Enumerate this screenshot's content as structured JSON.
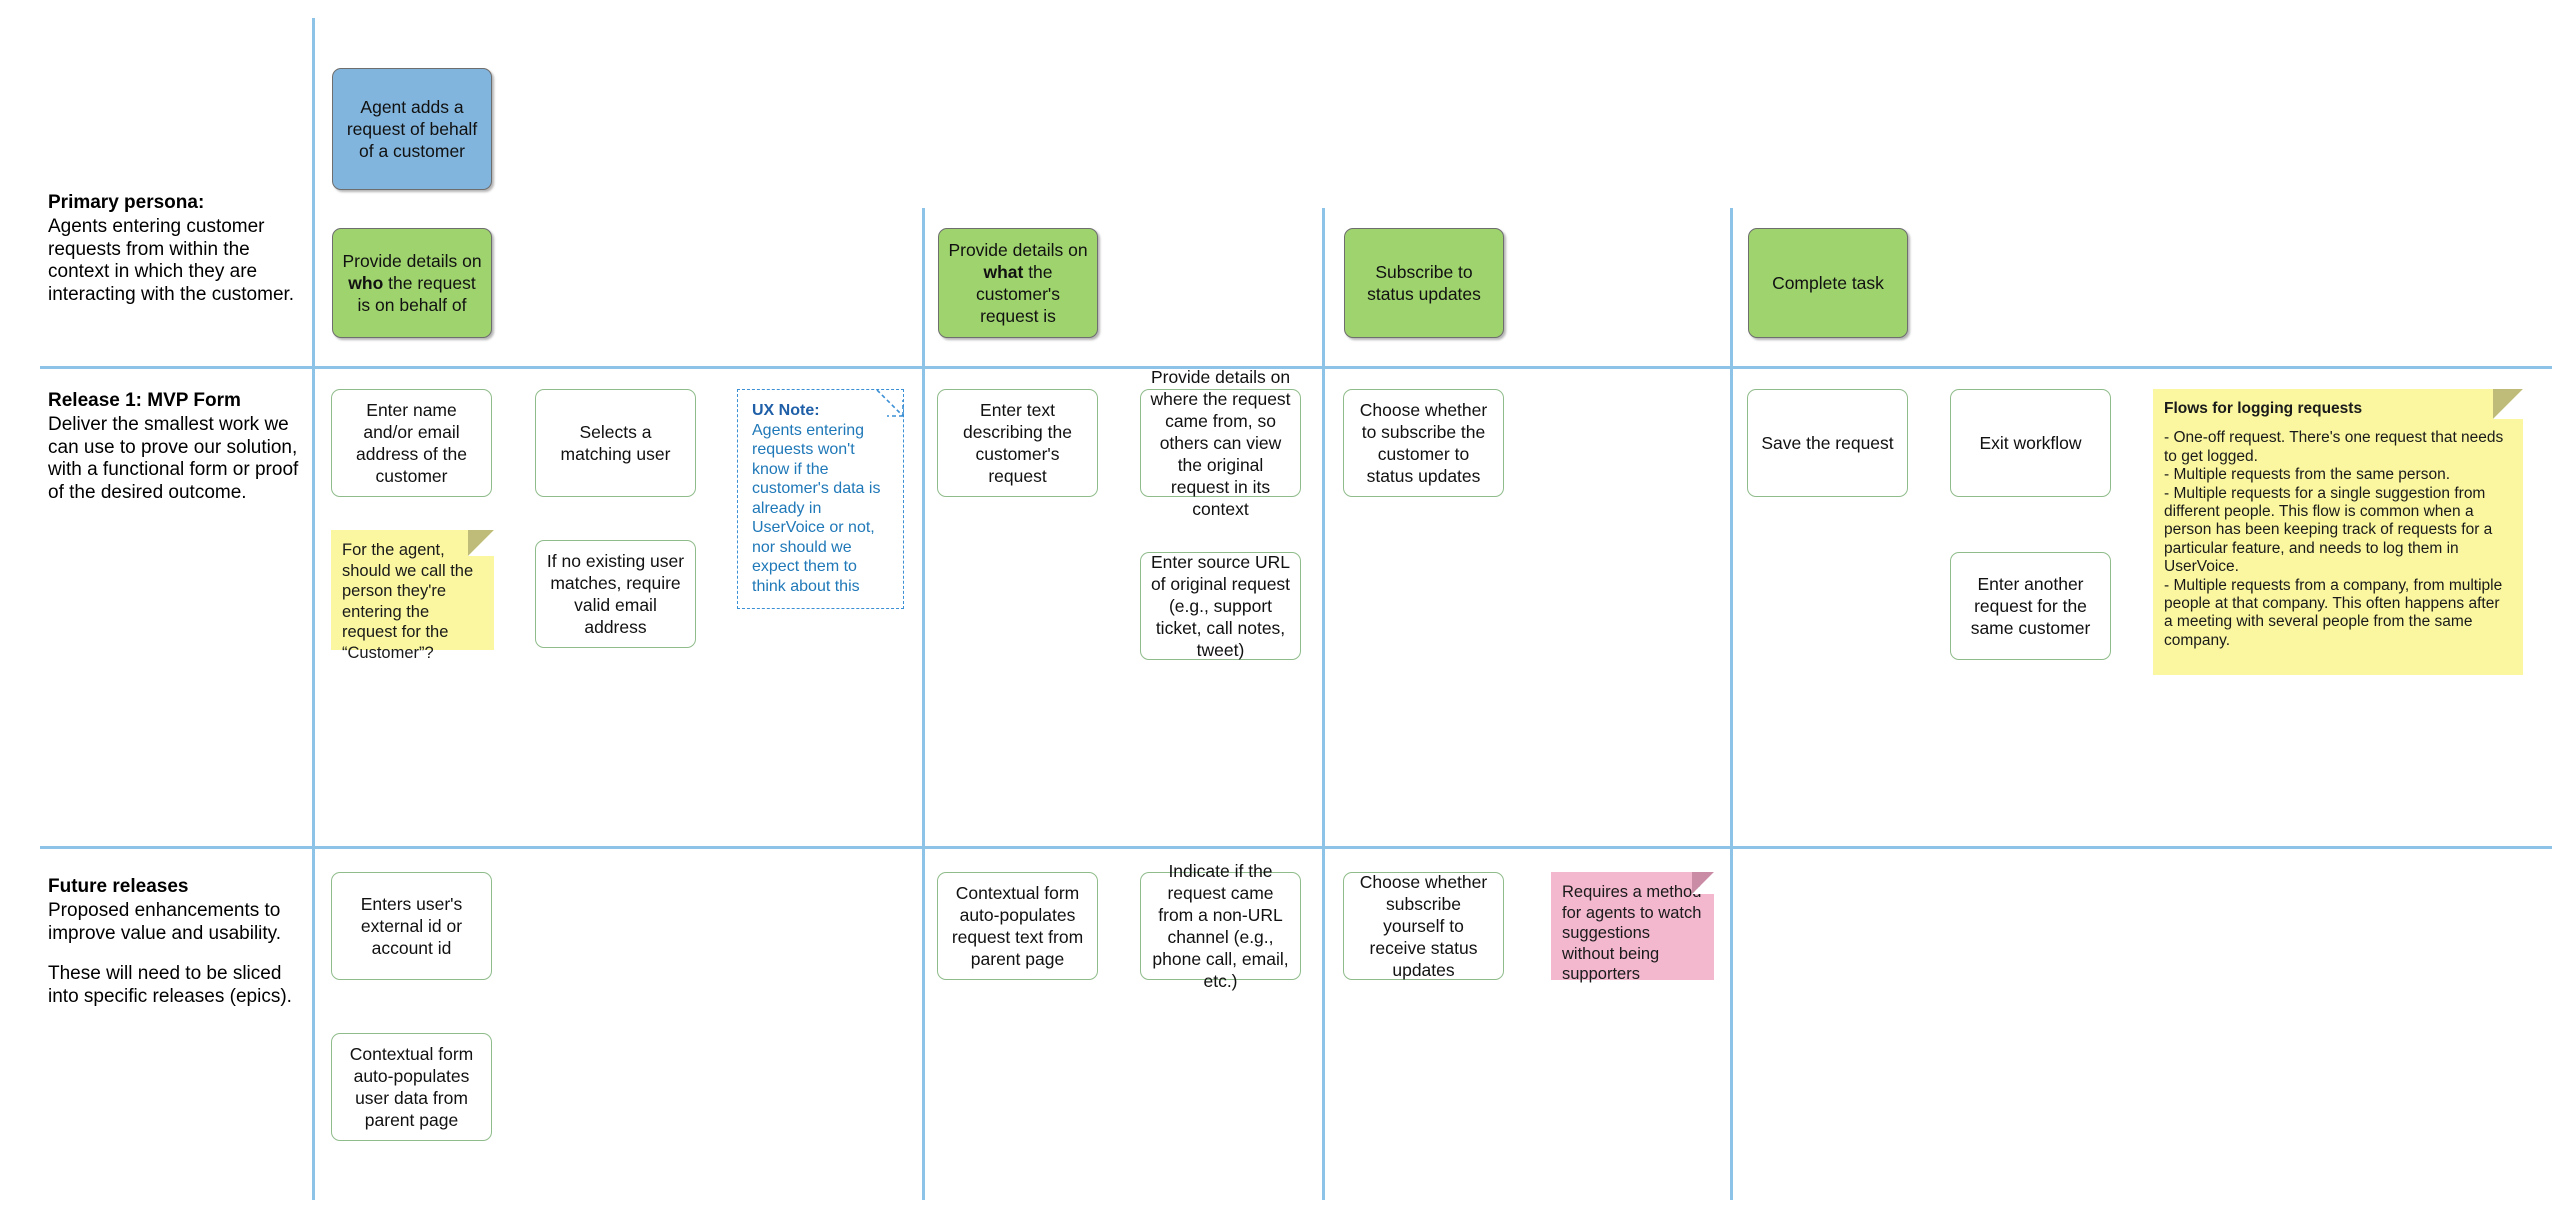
{
  "meta": {
    "accent_line_color": "#8EC3E8",
    "goal_card_color": "#82B5DD",
    "activity_card_color": "#9ED36E",
    "story_card_border": "#8FBC8B",
    "yellow_note_color": "#FAF7A0",
    "pink_note_color": "#F3B8CE",
    "ux_note_color": "#1F78B8"
  },
  "rows": [
    {
      "title": "Primary persona:",
      "desc1": "Agents entering customer requests from within the context in which they are interacting with the customer.",
      "desc2": ""
    },
    {
      "title": "Release 1: MVP Form",
      "desc1": "Deliver the smallest work we can use to prove our solution, with a functional form or proof of the desired outcome.",
      "desc2": ""
    },
    {
      "title": "Future releases",
      "desc1": "Proposed enhancements to improve value and usability.",
      "desc2": "These will need to be sliced into specific releases (epics)."
    }
  ],
  "backbone": {
    "goal": "Agent adds a request of behalf of a customer",
    "activities": [
      {
        "pre": "Provide details on ",
        "bold": "who",
        "post": " the request is on behalf of"
      },
      {
        "pre": "Provide details on ",
        "bold": "what",
        "post": " the customer's request is"
      },
      {
        "pre": "Subscribe to status updates",
        "bold": "",
        "post": ""
      },
      {
        "pre": "Complete task",
        "bold": "",
        "post": ""
      }
    ]
  },
  "release1": {
    "cards": [
      "Enter name and/or email address of the customer",
      "Selects a matching user",
      "If no existing user matches, require valid email address",
      "Enter text describing the customer's request",
      "Provide details on where the request came from, so others can view the original request in its context",
      "Enter source URL of original request (e.g., support ticket, call notes, tweet)",
      "Choose whether to subscribe the customer to status updates",
      "Save the request",
      "Exit workflow",
      "Enter another request for the same customer"
    ],
    "agent_note": "For the agent, should we call the person they're entering the request for the “Customer”?",
    "ux_note": {
      "title": "UX Note:",
      "body": "Agents entering requests won't know if the customer's data is already in UserVoice or not, nor should we expect them to think about this"
    },
    "flows_note": {
      "title": "Flows for logging requests",
      "body": "- One-off request. There's one request that needs to get logged.\n- Multiple requests from the same person.\n- Multiple requests for a single suggestion from different people. This flow is common when a person has been keeping track of requests for a particular feature, and needs to log them in UserVoice.\n- Multiple requests from a company, from multiple people at that company. This often happens after a meeting with several people from the same company."
    }
  },
  "future": {
    "cards": [
      "Enters user's external id or account id",
      "Contextual form auto-populates user data from parent page",
      "Contextual form auto-populates request text from parent page",
      "Indicate if the request came from a non-URL channel (e.g., phone call, email, etc.)",
      "Choose whether subscribe yourself to receive status updates"
    ],
    "supporters_note": "Requires a method for agents to watch suggestions without being supporters"
  }
}
